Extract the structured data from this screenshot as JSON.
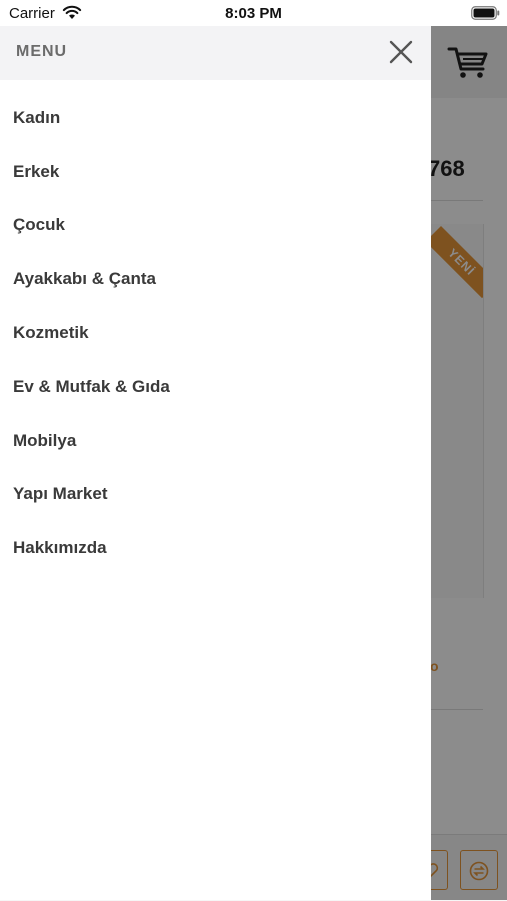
{
  "status_bar": {
    "carrier": "Carrier",
    "time": "8:03 PM"
  },
  "menu": {
    "title": "MENU",
    "items": [
      {
        "label": "Kadın"
      },
      {
        "label": "Erkek"
      },
      {
        "label": "Çocuk"
      },
      {
        "label": "Ayakkabı & Çanta"
      },
      {
        "label": "Kozmetik"
      },
      {
        "label": "Ev & Mutfak & Gıda"
      },
      {
        "label": "Mobilya"
      },
      {
        "label": "Yapı Market"
      },
      {
        "label": "Hakkımızda"
      }
    ]
  },
  "background": {
    "product_count_fragment": "768",
    "ribbon_label": "YENİ",
    "price_fragment": "o",
    "accent_color": "#e6953a"
  },
  "icons": {
    "wifi": "wifi-icon",
    "battery": "battery-icon",
    "cart": "cart-icon",
    "close": "close-icon",
    "favorite": "heart-icon",
    "compare": "compare-icon"
  }
}
